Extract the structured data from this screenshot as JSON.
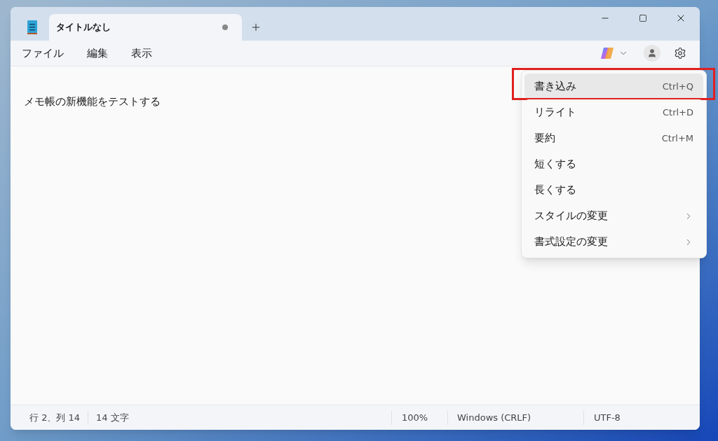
{
  "tabs": [
    {
      "title": "タイトルなし",
      "selected": true,
      "modified": true
    }
  ],
  "menu_bar": [
    "ファイル",
    "編集",
    "表示"
  ],
  "editor": {
    "text": "メモ帳の新機能をテストする"
  },
  "rewrite_menu": {
    "items": [
      {
        "label": "書き込み",
        "shortcut": "Ctrl+Q",
        "submenu": false,
        "highlighted": true,
        "annotated": true
      },
      {
        "label": "リライト",
        "shortcut": "Ctrl+D",
        "submenu": false,
        "highlighted": false,
        "annotated": false
      },
      {
        "label": "要約",
        "shortcut": "Ctrl+M",
        "submenu": false,
        "highlighted": false,
        "annotated": false
      },
      {
        "label": "短くする",
        "submenu": false,
        "highlighted": false,
        "annotated": false
      },
      {
        "label": "長くする",
        "submenu": false,
        "highlighted": false,
        "annotated": false
      },
      {
        "label": "スタイルの変更",
        "submenu": true,
        "highlighted": false,
        "annotated": false
      },
      {
        "label": "書式設定の変更",
        "submenu": true,
        "highlighted": false,
        "annotated": false
      }
    ]
  },
  "status_bar": {
    "position": "行 2、列 14",
    "characters": "14 文字",
    "zoom": "100%",
    "line_ending": "Windows (CRLF)",
    "encoding": "UTF-8"
  }
}
